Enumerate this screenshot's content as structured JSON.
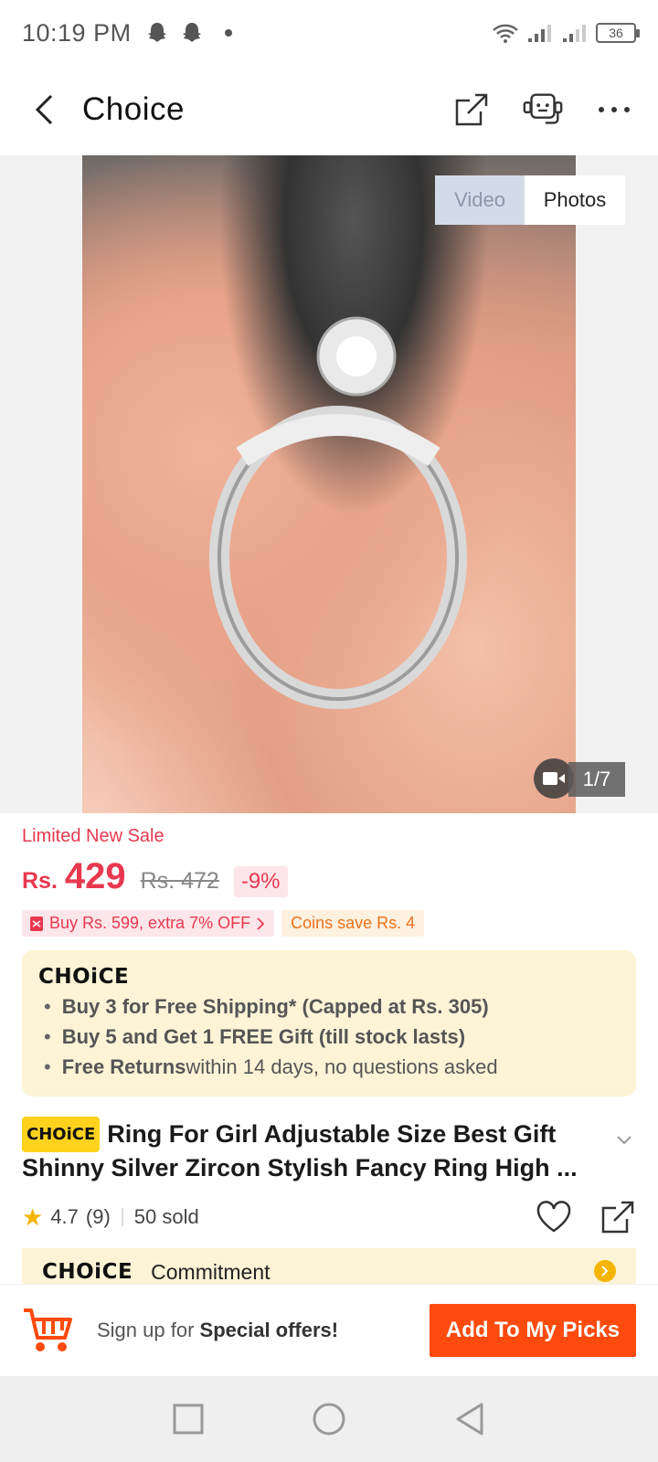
{
  "status_bar": {
    "time": "10:19 PM",
    "battery": "36"
  },
  "header": {
    "title": "Choice"
  },
  "gallery": {
    "toggle_video": "Video",
    "toggle_photos": "Photos",
    "counter": "1/7"
  },
  "price": {
    "sale_label": "Limited New Sale",
    "currency": "Rs.",
    "value": "429",
    "original": "Rs. 472",
    "discount": "-9%",
    "promo": "Buy Rs. 599, extra 7% OFF",
    "coins": "Coins save Rs. 4"
  },
  "choice_box": {
    "logo": "CHOiCE",
    "benefits": [
      {
        "bold": "Buy 3 for  Free Shipping* (Capped at Rs. 305)",
        "rest": ""
      },
      {
        "bold": "Buy 5 and Get 1 FREE Gift (till stock lasts)",
        "rest": ""
      },
      {
        "bold": "Free Returns",
        "rest": " within 14 days, no questions asked"
      }
    ]
  },
  "product": {
    "tag": "CHOiCE",
    "title": "Ring For Girl Adjustable Size Best Gift Shinny Silver Zircon Stylish Fancy Ring High ...",
    "rating": "4.7",
    "reviews": "(9)",
    "sold": "50 sold"
  },
  "commitment": {
    "logo": "CHOiCE",
    "label": "Commitment"
  },
  "action_bar": {
    "signup_prefix": "Sign up for ",
    "signup_bold": "Special offers!",
    "button": "Add To My Picks"
  },
  "colors": {
    "accent": "#e8384f",
    "button": "#fd4b0e",
    "choice_bg": "#fdf3d6",
    "choice_tag": "#ffd21e"
  }
}
